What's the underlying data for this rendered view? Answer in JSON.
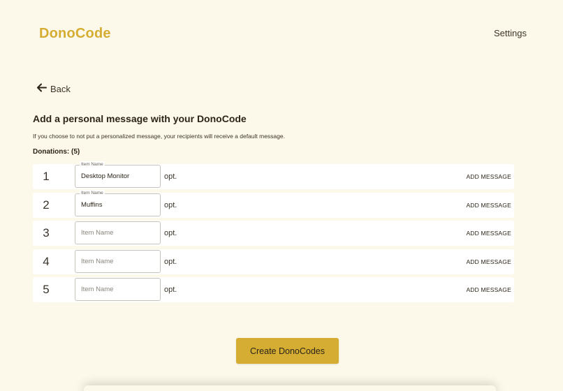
{
  "header": {
    "logo": "DonoCode",
    "settings_label": "Settings"
  },
  "back": {
    "label": "Back"
  },
  "form": {
    "heading": "Add a personal message with your DonoCode",
    "subtext": "If you choose to not put a personalized message, your recipients will receive a default message.",
    "donations_label": "Donations: (5)",
    "field_legend": "Item Name",
    "field_placeholder": "Item Name",
    "opt_label": "opt.",
    "add_message_label": "ADD MESSAGE",
    "rows": [
      {
        "number": "1",
        "value": "Desktop Monitor"
      },
      {
        "number": "2",
        "value": "Muffins"
      },
      {
        "number": "3",
        "value": ""
      },
      {
        "number": "4",
        "value": ""
      },
      {
        "number": "5",
        "value": ""
      }
    ]
  },
  "footer": {
    "create_button": "Create DonoCodes"
  },
  "colors": {
    "background": "#fcf9ea",
    "accent": "#d4ad32"
  }
}
